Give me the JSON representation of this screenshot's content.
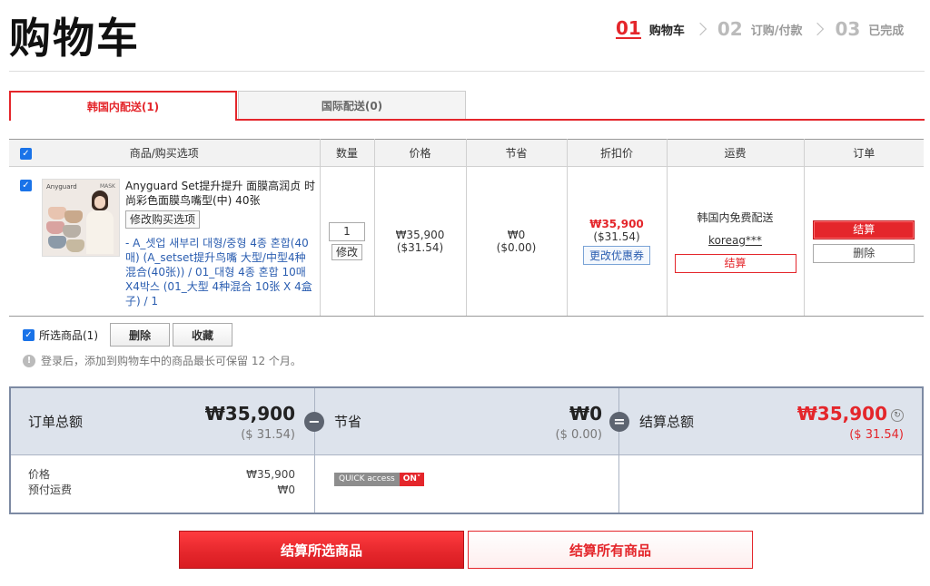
{
  "header": {
    "title": "购物车",
    "steps": [
      {
        "num": "01",
        "label": "购物车"
      },
      {
        "num": "02",
        "label": "订购/付款"
      },
      {
        "num": "03",
        "label": "已完成"
      }
    ]
  },
  "tabs": {
    "domestic": "韩国内配送(1)",
    "international": "国际配送(0)"
  },
  "table": {
    "headers": {
      "product": "商品/购买选项",
      "qty": "数量",
      "price": "价格",
      "savings": "节省",
      "discount_price": "折扣价",
      "shipping": "运费",
      "order": "订单"
    },
    "item": {
      "name": "Anyguard Set提升提升 面膜高润贞 时尚彩色面膜鸟嘴型(中) 40张",
      "change_option": "修改购买选项",
      "option": "- A_셋업 새부리 대형/중형 4종 혼합(40매) (A_setset提升鸟嘴 大型/中型4种混合(40张)) / 01_대형 4종 혼합 10매X4박스 (01_大型 4种混合 10张 X 4盒子) / 1",
      "image_brand": "Anyguard",
      "image_brand2": "MASK",
      "qty": "1",
      "qty_button": "修改",
      "price_krw": "₩35,900",
      "price_usd": "($31.54)",
      "savings_krw": "₩0",
      "savings_usd": "($0.00)",
      "discount_krw": "₩35,900",
      "discount_usd": "($31.54)",
      "coupon_button": "更改优惠券",
      "shipping_text": "韩国内免费配送",
      "seller": "koreag***",
      "shipping_checkout": "结算",
      "checkout": "结算",
      "delete": "删除"
    }
  },
  "selection": {
    "label": "所选商品(1)",
    "delete": "删除",
    "favorite": "收藏",
    "notice": "登录后，添加到购物车中的商品最长可保留 12 个月。"
  },
  "summary": {
    "order_total_label": "订单总额",
    "order_total_krw": "₩35,900",
    "order_total_usd": "($ 31.54)",
    "minus": "−",
    "savings_label": "节省",
    "savings_krw": "₩0",
    "savings_usd": "($ 0.00)",
    "equals": "=",
    "checkout_total_label": "结算总额",
    "checkout_total_krw": "₩35,900",
    "checkout_total_usd": "($ 31.54)",
    "price_label": "价格",
    "price_value": "₩35,900",
    "prepaid_shipping_label": "预付运费",
    "prepaid_shipping_value": "₩0",
    "quick_access": "QUICK access",
    "quick_on": "ON"
  },
  "buttons": {
    "checkout_selected": "结算所选商品",
    "checkout_all": "结算所有商品"
  },
  "colors": {
    "accent": "#e4262b",
    "link": "#2a5db0",
    "summary_bg": "#dde3ec"
  }
}
